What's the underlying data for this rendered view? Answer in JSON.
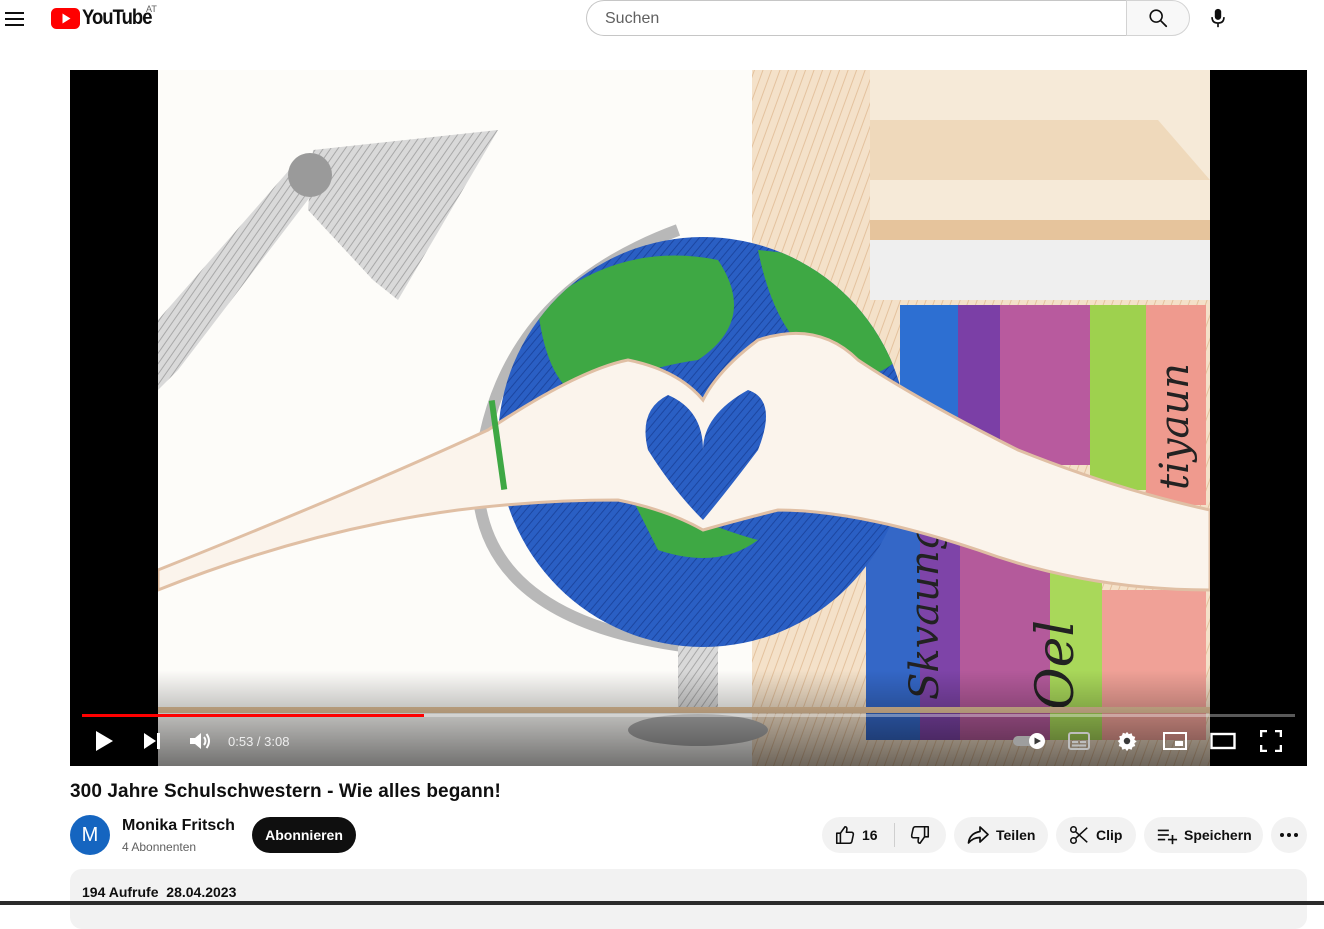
{
  "masthead": {
    "logo_text": "YouTube",
    "country_code": "AT",
    "search_placeholder": "Suchen"
  },
  "player": {
    "current_time": "0:53",
    "duration": "3:08",
    "time_display": "0:53 / 3:08",
    "progress_fraction": 0.282,
    "autoplay_on": true
  },
  "video": {
    "title": "300 Jahre Schulschwestern - Wie alles begann!",
    "views": "194 Aufrufe",
    "date": "28.04.2023"
  },
  "channel": {
    "avatar_letter": "M",
    "name": "Monika Fritsch",
    "subscribers": "4 Abonnenten",
    "subscribe_label": "Abonnieren"
  },
  "actions": {
    "like_count": "16",
    "share_label": "Teilen",
    "clip_label": "Clip",
    "save_label": "Speichern"
  },
  "colors": {
    "brand_red": "#ff0000",
    "avatar_bg": "#1565c0",
    "pill_bg": "#f2f2f2"
  }
}
